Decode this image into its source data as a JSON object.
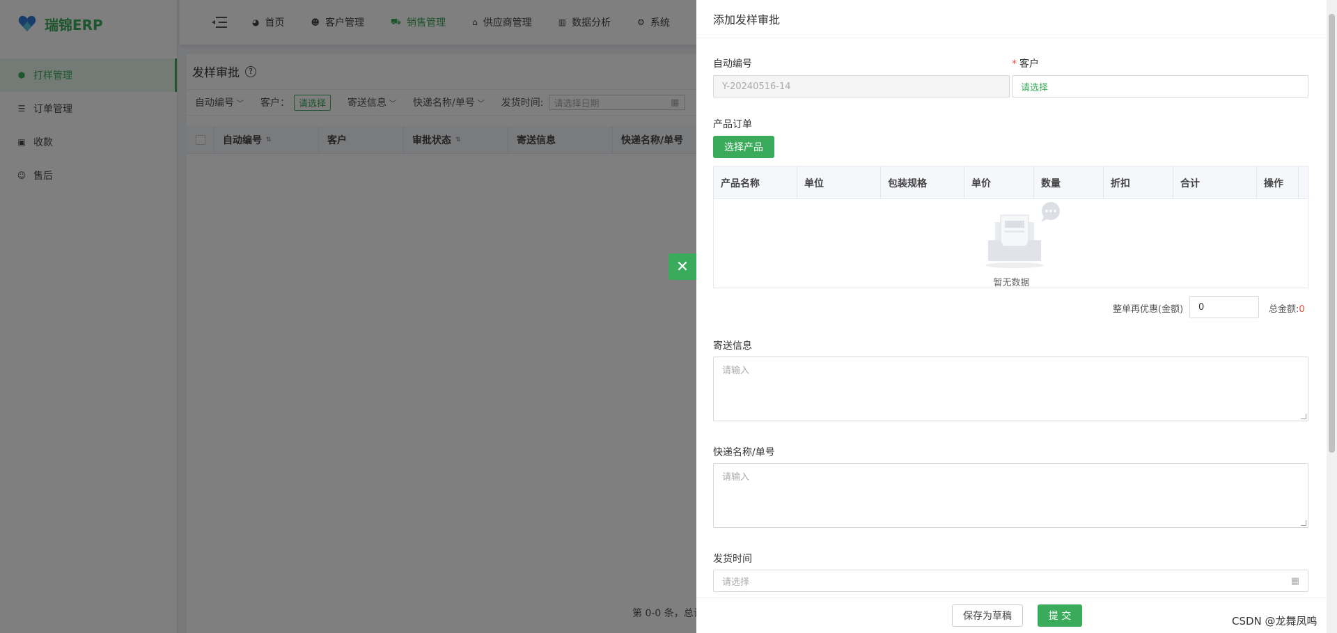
{
  "app": {
    "name": "瑞锦ERP"
  },
  "colors": {
    "brand": "#3aab5a",
    "danger": "#e74c3c"
  },
  "sidebar": {
    "items": [
      {
        "label": "打样管理",
        "icon": "cube-icon",
        "active": true
      },
      {
        "label": "订单管理",
        "icon": "list-icon",
        "active": false
      },
      {
        "label": "收款",
        "icon": "money-icon",
        "active": false
      },
      {
        "label": "售后",
        "icon": "user-service-icon",
        "active": false
      }
    ]
  },
  "topnav": {
    "items": [
      {
        "label": "首页",
        "icon": "dashboard-icon",
        "active": false
      },
      {
        "label": "客户管理",
        "icon": "customer-icon",
        "active": false
      },
      {
        "label": "销售管理",
        "icon": "cart-icon",
        "active": true
      },
      {
        "label": "供应商管理",
        "icon": "bank-icon",
        "active": false
      },
      {
        "label": "数据分析",
        "icon": "chart-icon",
        "active": false
      },
      {
        "label": "系统",
        "icon": "gear-icon",
        "active": false
      }
    ]
  },
  "page": {
    "title": "发样审批",
    "filters": {
      "auto_no": "自动编号",
      "customer_label": "客户：",
      "customer_btn": "请选择",
      "shipping": "寄送信息",
      "express": "快递名称/单号",
      "ship_time_label": "发货时间:",
      "date_placeholder": "请选择日期"
    },
    "table": {
      "columns": [
        "自动编号",
        "客户",
        "审批状态",
        "寄送信息",
        "快递名称/单号"
      ]
    },
    "pagination": "第 0-0 条，总计"
  },
  "drawer": {
    "title": "添加发样审批",
    "auto_no": {
      "label": "自动编号",
      "value": "Y-20240516-14"
    },
    "customer": {
      "label": "客户",
      "required_mark": "*",
      "placeholder": "请选择"
    },
    "product_order": {
      "label": "产品订单",
      "select_button": "选择产品",
      "columns": [
        "产品名称",
        "单位",
        "包装规格",
        "单价",
        "数量",
        "折扣",
        "合计",
        "操作"
      ],
      "empty_text": "暂无数据"
    },
    "discount": {
      "label": "整单再优惠(金额)",
      "value": "0"
    },
    "total": {
      "label": "总金额:",
      "value": "0"
    },
    "shipping_info": {
      "label": "寄送信息",
      "placeholder": "请输入"
    },
    "express": {
      "label": "快递名称/单号",
      "placeholder": "请输入"
    },
    "ship_time": {
      "label": "发货时间",
      "placeholder": "请选择"
    },
    "buttons": {
      "save_draft": "保存为草稿",
      "submit": "提 交"
    }
  },
  "watermark": "CSDN @龙舞凤鸣"
}
